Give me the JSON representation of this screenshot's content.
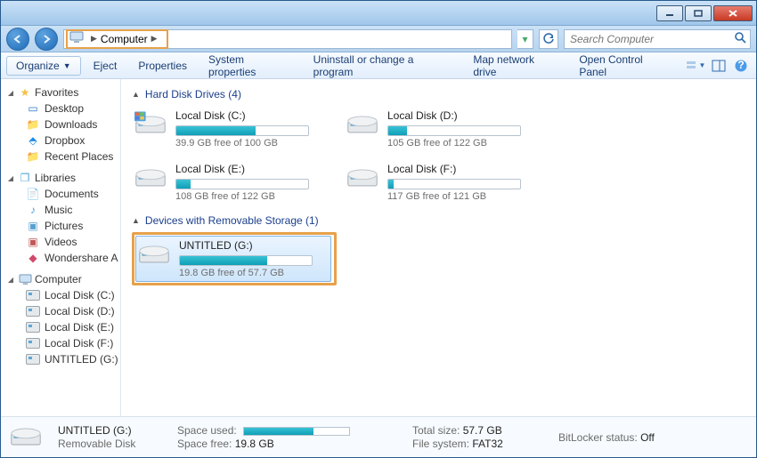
{
  "window": {
    "title": "Computer"
  },
  "address": {
    "location": "Computer"
  },
  "search": {
    "placeholder": "Search Computer"
  },
  "toolbar": {
    "organize": "Organize",
    "items": [
      "Eject",
      "Properties",
      "System properties",
      "Uninstall or change a program",
      "Map network drive",
      "Open Control Panel"
    ]
  },
  "sidebar": {
    "favorites": {
      "label": "Favorites",
      "items": [
        "Desktop",
        "Downloads",
        "Dropbox",
        "Recent Places"
      ]
    },
    "libraries": {
      "label": "Libraries",
      "items": [
        "Documents",
        "Music",
        "Pictures",
        "Videos",
        "Wondershare A"
      ]
    },
    "computer": {
      "label": "Computer",
      "items": [
        "Local Disk (C:)",
        "Local Disk (D:)",
        "Local Disk (E:)",
        "Local Disk (F:)",
        "UNTITLED (G:)"
      ]
    }
  },
  "content": {
    "hdd_header": "Hard Disk Drives (4)",
    "removable_header": "Devices with Removable Storage (1)",
    "drives": [
      {
        "name": "Local Disk (C:)",
        "free": "39.9 GB free of 100 GB",
        "fill_pct": 60
      },
      {
        "name": "Local Disk (D:)",
        "free": "105 GB free of 122 GB",
        "fill_pct": 14
      },
      {
        "name": "Local Disk (E:)",
        "free": "108 GB free of 122 GB",
        "fill_pct": 11
      },
      {
        "name": "Local Disk (F:)",
        "free": "117 GB free of 121 GB",
        "fill_pct": 4
      }
    ],
    "removable": [
      {
        "name": "UNTITLED (G:)",
        "free": "19.8 GB free of 57.7 GB",
        "fill_pct": 66
      }
    ]
  },
  "details": {
    "title": "UNTITLED (G:)",
    "subtitle": "Removable Disk",
    "space_used_label": "Space used:",
    "space_used_pct": 66,
    "space_free_label": "Space free:",
    "space_free": "19.8 GB",
    "total_size_label": "Total size:",
    "total_size": "57.7 GB",
    "fs_label": "File system:",
    "fs": "FAT32",
    "bitlocker_label": "BitLocker status:",
    "bitlocker": "Off"
  }
}
